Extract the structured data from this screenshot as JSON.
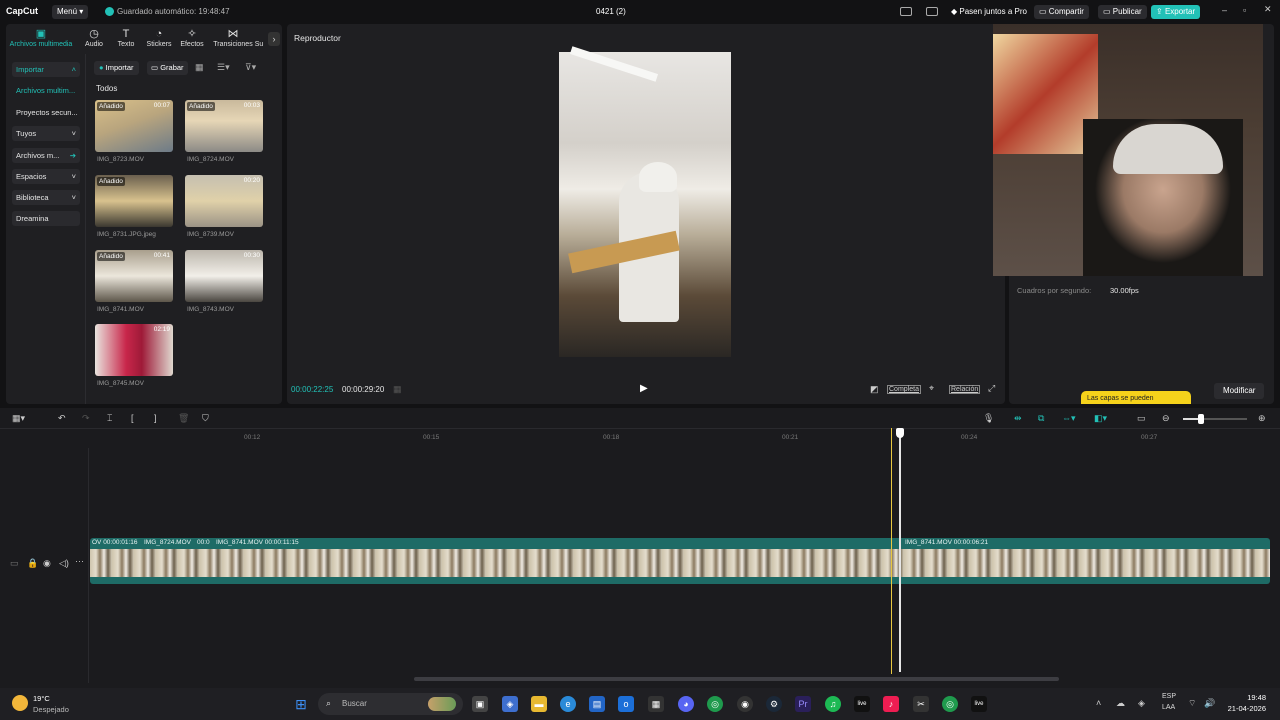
{
  "app": {
    "logo": "CapCut",
    "menu": "Menú",
    "autosave": "Guardado automático: 19:48:47",
    "project": "0421 (2)"
  },
  "titlebar": {
    "pro": "Pasen juntos a Pro",
    "share": "Compartir",
    "publish": "Publicar",
    "export": "Exportar"
  },
  "media_tabs": [
    {
      "label": "Archivos multimedia",
      "icon": "media-icon"
    },
    {
      "label": "Audio",
      "icon": "audio-icon"
    },
    {
      "label": "Texto",
      "icon": "text-icon"
    },
    {
      "label": "Stickers",
      "icon": "sticker-icon"
    },
    {
      "label": "Efectos",
      "icon": "effects-icon"
    },
    {
      "label": "Transiciones",
      "icon": "transition-icon"
    },
    {
      "label": "Su",
      "icon": ""
    }
  ],
  "sidebar": [
    {
      "label": "Importar"
    },
    {
      "label": "Archivos multim..."
    },
    {
      "label": "Proyectos secun..."
    },
    {
      "label": "Tuyos"
    },
    {
      "label": "Archivos m..."
    },
    {
      "label": "Espacios"
    },
    {
      "label": "Biblioteca"
    },
    {
      "label": "Dreamina"
    }
  ],
  "media_toolbar": {
    "import": "Importar",
    "record": "Grabar"
  },
  "media": {
    "section": "Todos",
    "items": [
      {
        "name": "IMG_8723.MOV",
        "dur": "00:07",
        "badge": "Añadido"
      },
      {
        "name": "IMG_8724.MOV",
        "dur": "00:03",
        "badge": "Añadido"
      },
      {
        "name": "IMG_8731.JPG.jpeg",
        "dur": "",
        "badge": "Añadido"
      },
      {
        "name": "IMG_8739.MOV",
        "dur": "00:20",
        "badge": ""
      },
      {
        "name": "IMG_8741.MOV",
        "dur": "00:41",
        "badge": "Añadido"
      },
      {
        "name": "IMG_8743.MOV",
        "dur": "00:30",
        "badge": ""
      },
      {
        "name": "IMG_8745.MOV",
        "dur": "02:19",
        "badge": ""
      }
    ]
  },
  "player": {
    "title": "Reproductor",
    "current": "00:00:22:25",
    "total": "00:00:29:20",
    "full": "Completa",
    "ratio": "Relación"
  },
  "props": {
    "fps_label": "Cuadros por segundo:",
    "fps_value": "30.00fps",
    "tooltip": "Las capas se pueden",
    "modify": "Modificar"
  },
  "ruler": [
    "00:12",
    "00:15",
    "00:18",
    "00:21",
    "00:24",
    "00:27"
  ],
  "clips": {
    "c1": "OV  00:00:01:16",
    "c2": "IMG_8724.MOV",
    "c3": "00:0",
    "c4": "IMG_8741.MOV  00:00:11:15",
    "c5": "IMG_8741.MOV  00:00:06:21"
  },
  "taskbar": {
    "temp": "19°C",
    "weather": "Despejado",
    "search": "Buscar",
    "lang1": "ESP",
    "lang2": "LAA",
    "time": "19:48",
    "date": "21-04-2026"
  },
  "colors": {
    "accent": "#22c1b7",
    "track": "#1e6b66",
    "playhead": "#e8c840",
    "tooltip": "#f5d21b"
  }
}
